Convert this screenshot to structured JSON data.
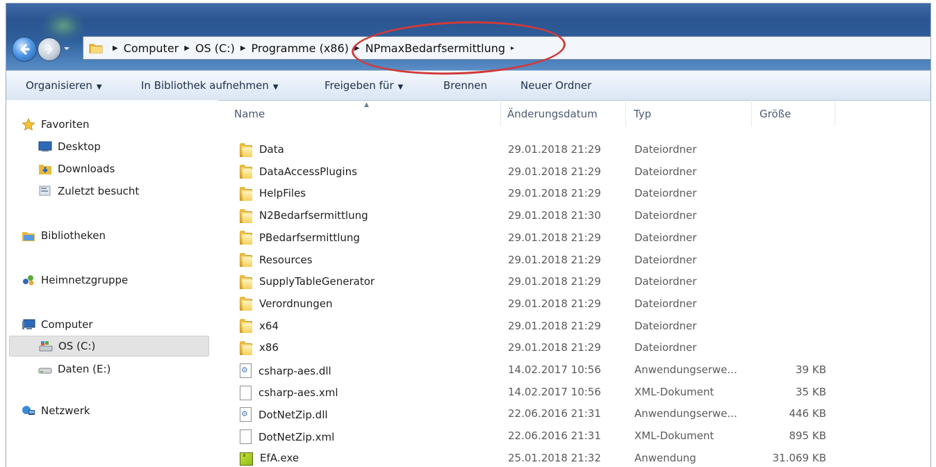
{
  "address": {
    "crumbs": [
      "Computer",
      "OS (C:)",
      "Programme (x86)",
      "NPmaxBedarfsermittlung"
    ],
    "trailing_arrow": "▸"
  },
  "toolbar": {
    "organize": "Organisieren",
    "library": "In Bibliothek aufnehmen",
    "share": "Freigeben für",
    "burn": "Brennen",
    "new_folder": "Neuer Ordner"
  },
  "nav": {
    "favorites": "Favoriten",
    "desktop": "Desktop",
    "downloads": "Downloads",
    "recent": "Zuletzt besucht",
    "libraries": "Bibliotheken",
    "homegroup": "Heimnetzgruppe",
    "computer": "Computer",
    "drive_c": "OS (C:)",
    "drive_e": "Daten (E:)",
    "network": "Netzwerk"
  },
  "columns": {
    "name": "Name",
    "date": "Änderungsdatum",
    "type": "Typ",
    "size": "Größe"
  },
  "files": [
    {
      "name": "Data",
      "date": "29.01.2018 21:29",
      "type": "Dateiordner",
      "size": "",
      "icon": "folder-icon"
    },
    {
      "name": "DataAccessPlugins",
      "date": "29.01.2018 21:29",
      "type": "Dateiordner",
      "size": "",
      "icon": "folder-icon"
    },
    {
      "name": "HelpFiles",
      "date": "29.01.2018 21:29",
      "type": "Dateiordner",
      "size": "",
      "icon": "folder-icon"
    },
    {
      "name": "N2Bedarfsermittlung",
      "date": "29.01.2018 21:30",
      "type": "Dateiordner",
      "size": "",
      "icon": "folder-icon"
    },
    {
      "name": "PBedarfsermittlung",
      "date": "29.01.2018 21:29",
      "type": "Dateiordner",
      "size": "",
      "icon": "folder-icon"
    },
    {
      "name": "Resources",
      "date": "29.01.2018 21:29",
      "type": "Dateiordner",
      "size": "",
      "icon": "folder-icon"
    },
    {
      "name": "SupplyTableGenerator",
      "date": "29.01.2018 21:29",
      "type": "Dateiordner",
      "size": "",
      "icon": "folder-icon"
    },
    {
      "name": "Verordnungen",
      "date": "29.01.2018 21:29",
      "type": "Dateiordner",
      "size": "",
      "icon": "folder-icon"
    },
    {
      "name": "x64",
      "date": "29.01.2018 21:29",
      "type": "Dateiordner",
      "size": "",
      "icon": "folder-icon"
    },
    {
      "name": "x86",
      "date": "29.01.2018 21:29",
      "type": "Dateiordner",
      "size": "",
      "icon": "folder-icon"
    },
    {
      "name": "csharp-aes.dll",
      "date": "14.02.2017 10:56",
      "type": "Anwendungserwe...",
      "size": "39 KB",
      "icon": "dll-icon"
    },
    {
      "name": "csharp-aes.xml",
      "date": "14.02.2017 10:56",
      "type": "XML-Dokument",
      "size": "35 KB",
      "icon": "document-icon"
    },
    {
      "name": "DotNetZip.dll",
      "date": "22.06.2016 21:31",
      "type": "Anwendungserwe...",
      "size": "446 KB",
      "icon": "dll-icon"
    },
    {
      "name": "DotNetZip.xml",
      "date": "22.06.2016 21:31",
      "type": "XML-Dokument",
      "size": "895 KB",
      "icon": "document-icon"
    },
    {
      "name": "EfA.exe",
      "date": "25.01.2018 21:32",
      "type": "Anwendung",
      "size": "31.069 KB",
      "icon": "exe-icon"
    }
  ],
  "colors": {
    "highlight_ellipse": "#d03a3a",
    "toolbar_text": "#1e3049",
    "selected_nav_bg": "#e3e3e3"
  }
}
